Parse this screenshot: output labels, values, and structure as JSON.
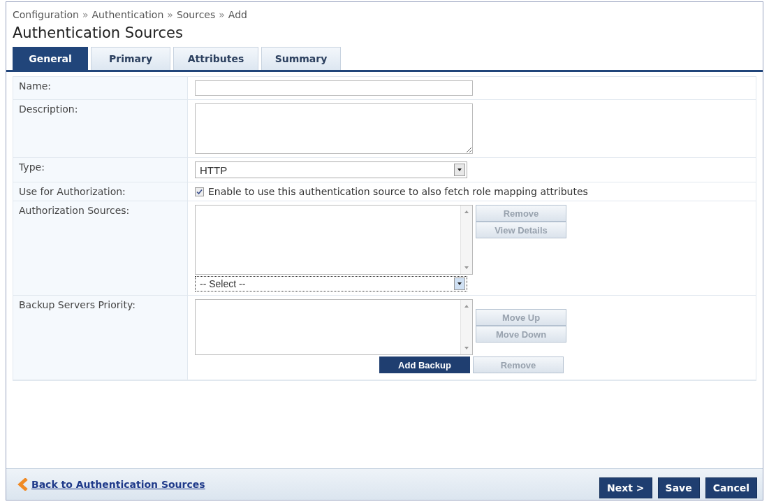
{
  "breadcrumb": [
    "Configuration",
    "Authentication",
    "Sources",
    "Add"
  ],
  "breadcrumb_separator": "»",
  "title": "Authentication Sources",
  "tabs": [
    {
      "label": "General",
      "selected": true
    },
    {
      "label": "Primary",
      "selected": false
    },
    {
      "label": "Attributes",
      "selected": false
    },
    {
      "label": "Summary",
      "selected": false
    }
  ],
  "form": {
    "name": {
      "label": "Name:"
    },
    "description": {
      "label": "Description:"
    },
    "type": {
      "label": "Type:",
      "value": "HTTP"
    },
    "use_for_authorization": {
      "label": "Use for Authorization:",
      "checked": true,
      "text": "Enable to use this authentication source to also fetch role mapping attributes"
    },
    "authorization_sources": {
      "label": "Authorization Sources:",
      "select_value": "-- Select --",
      "buttons": [
        {
          "label": "Remove",
          "disabled": true
        },
        {
          "label": "View Details",
          "disabled": true
        }
      ]
    },
    "backup_servers": {
      "label": "Backup Servers Priority:",
      "buttons": [
        {
          "label": "Move Up",
          "disabled": true
        },
        {
          "label": "Move Down",
          "disabled": true
        }
      ],
      "bottom_buttons": [
        {
          "label": "Add Backup",
          "disabled": false
        },
        {
          "label": "Remove",
          "disabled": true
        }
      ]
    }
  },
  "footer": {
    "back_link": "Back to Authentication Sources",
    "buttons": [
      "Next >",
      "Save",
      "Cancel"
    ]
  }
}
